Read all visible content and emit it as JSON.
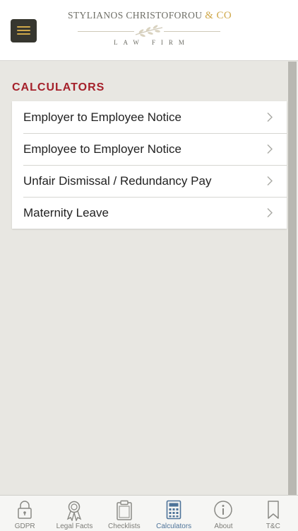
{
  "header": {
    "logo_name": "STYLIANOS CHRISTOFOROU",
    "logo_amp": "& CO",
    "logo_sub": "LAW FIRM"
  },
  "section": {
    "title": "CALCULATORS"
  },
  "items": [
    {
      "label": "Employer to Employee Notice"
    },
    {
      "label": "Employee to Employer Notice"
    },
    {
      "label": "Unfair Dismissal / Redundancy Pay"
    },
    {
      "label": "Maternity Leave"
    }
  ],
  "tabs": [
    {
      "label": "GDPR",
      "icon": "lock-icon"
    },
    {
      "label": "Legal Facts",
      "icon": "award-ribbon-icon"
    },
    {
      "label": "Checklists",
      "icon": "clipboard-icon"
    },
    {
      "label": "Calculators",
      "icon": "calculator-icon",
      "active": true
    },
    {
      "label": "About",
      "icon": "info-icon"
    },
    {
      "label": "T&C",
      "icon": "bookmark-icon"
    }
  ],
  "colors": {
    "accent": "#a5212b",
    "gold": "#cfa84a",
    "active_tab": "#4d7399",
    "background": "#e8e7e2"
  }
}
